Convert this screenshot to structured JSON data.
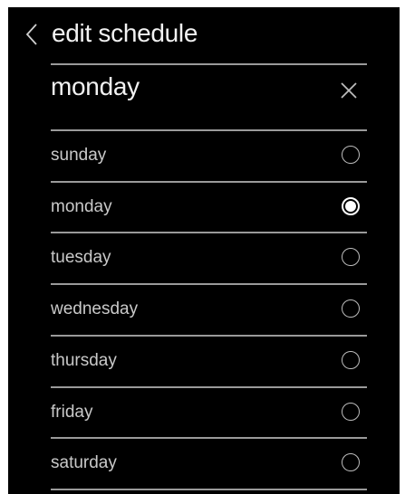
{
  "header": {
    "title": "edit schedule",
    "back_icon": "chevron-left-icon"
  },
  "selection": {
    "value": "monday",
    "clear_icon": "close-icon"
  },
  "days": [
    {
      "label": "sunday",
      "selected": false
    },
    {
      "label": "monday",
      "selected": true
    },
    {
      "label": "tuesday",
      "selected": false
    },
    {
      "label": "wednesday",
      "selected": false
    },
    {
      "label": "thursday",
      "selected": false
    },
    {
      "label": "friday",
      "selected": false
    },
    {
      "label": "saturday",
      "selected": false
    }
  ],
  "colors": {
    "background": "#000000",
    "text": "#f2f2f2",
    "divider": "#9a9a9a"
  }
}
